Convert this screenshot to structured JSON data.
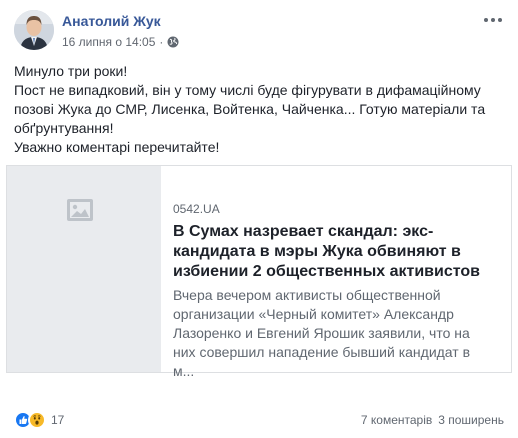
{
  "post": {
    "author": "Анатолий Жук",
    "timestamp": "16 липня о 14:05",
    "privacy_icon": "globe-icon",
    "more_icon": "more-options-icon",
    "body_lines": [
      "Минуло три роки!",
      "Пост не випадковий, він у тому числі буде фігурувати в дифамаційному позові Жука до СМР, Лисенка, Войтенка, Чайченка... Готую матеріали та обґрунтування!",
      "Уважно коментарі перечитайте!"
    ]
  },
  "link": {
    "source": "0542.UA",
    "title": "В Сумах назревает скандал: экс-кандидата в мэры Жука обвиняют в избиении 2 общественных активистов",
    "description": "Вчера вечером активисты общественной организации «Черный комитет» Александр Лазоренко и Евгений Ярошик заявили, что на них совершил нападение бывший кандидат в м...",
    "thumbnail_icon": "image-placeholder-icon"
  },
  "footer": {
    "reaction_icons": [
      "like-icon",
      "wow-icon"
    ],
    "reaction_count": "17",
    "comments": "7 коментарів",
    "shares": "3 поширень"
  },
  "colors": {
    "author": "#385898",
    "meta": "#616770",
    "like": "#1877f2",
    "wow": "#f7b928",
    "card_border": "#dddfe2",
    "thumb_bg": "#e9ebee"
  }
}
